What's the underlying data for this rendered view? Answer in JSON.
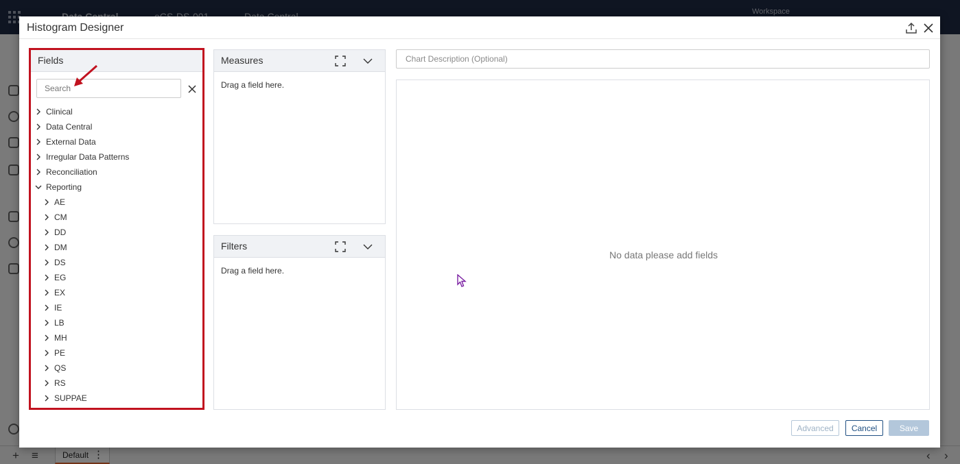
{
  "background_app": {
    "title": "Data Central",
    "study": "eCS-DS-001",
    "module": "Data Central",
    "workspace_label": "Workspace",
    "bottom_tab": "Default"
  },
  "modal": {
    "title": "Histogram Designer"
  },
  "fields": {
    "title": "Fields",
    "search_placeholder": "Search",
    "items": [
      {
        "label": "Clinical",
        "expanded": false
      },
      {
        "label": "Data Central",
        "expanded": false
      },
      {
        "label": "External Data",
        "expanded": false
      },
      {
        "label": "Irregular Data Patterns",
        "expanded": false
      },
      {
        "label": "Reconciliation",
        "expanded": false
      },
      {
        "label": "Reporting",
        "expanded": true
      }
    ],
    "reporting_children": [
      "AE",
      "CM",
      "DD",
      "DM",
      "DS",
      "EG",
      "EX",
      "IE",
      "LB",
      "MH",
      "PE",
      "QS",
      "RS",
      "SUPPAE"
    ]
  },
  "measures": {
    "title": "Measures",
    "hint": "Drag a field here."
  },
  "filters": {
    "title": "Filters",
    "hint": "Drag a field here."
  },
  "chart": {
    "description_placeholder": "Chart Description (Optional)",
    "empty_message": "No data please add fields"
  },
  "footer": {
    "advanced_label": "Advanced",
    "cancel_label": "Cancel",
    "save_label": "Save"
  },
  "colors": {
    "highlight_border": "#c1121f",
    "primary": "#1f4f82",
    "disabled_primary": "#b3c7db"
  }
}
